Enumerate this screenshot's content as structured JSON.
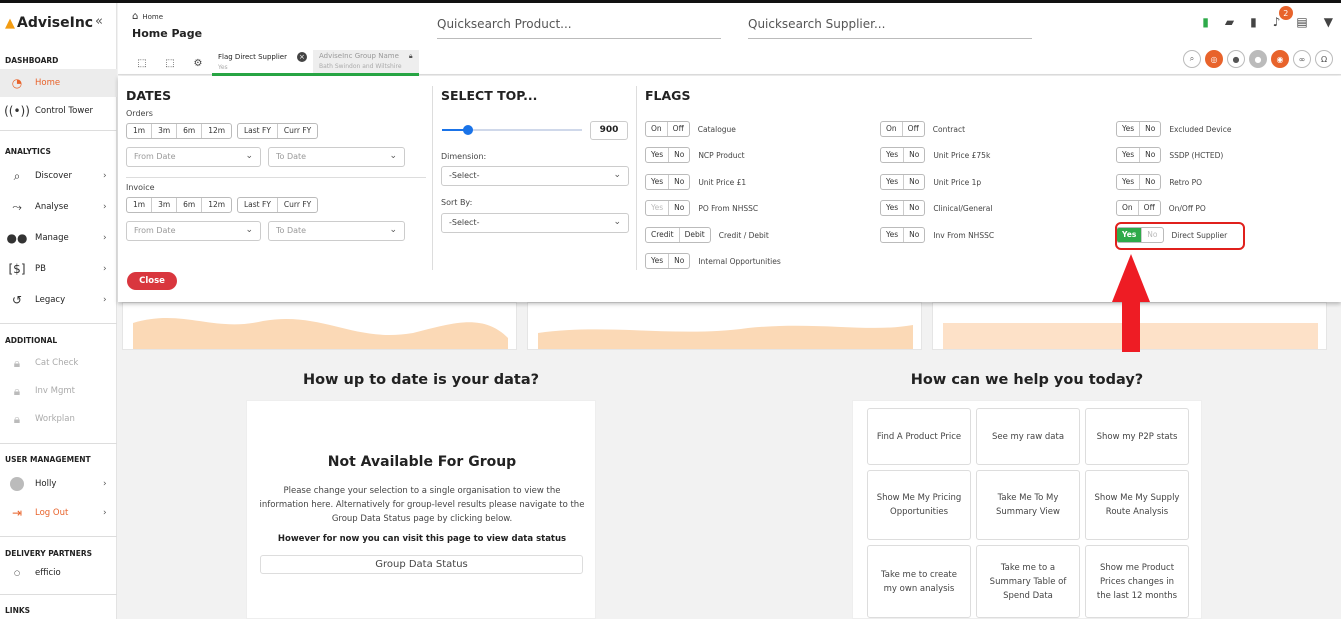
{
  "app": {
    "logo": "AdviseInc"
  },
  "sidebar": {
    "sections": {
      "dashboard": "DASHBOARD",
      "analytics": "ANALYTICS",
      "additional": "ADDITIONAL",
      "user_management": "USER MANAGEMENT",
      "delivery_partners": "DELIVERY PARTNERS",
      "links": "LINKS"
    },
    "items": {
      "home": "Home",
      "control_tower": "Control Tower",
      "discover": "Discover",
      "analyse": "Analyse",
      "manage": "Manage",
      "pb": "PB",
      "legacy": "Legacy",
      "cat_check": "Cat Check",
      "inv_mgmt": "Inv Mgmt",
      "workplan": "Workplan",
      "user": "Holly",
      "logout": "Log Out",
      "partner": "efficio"
    }
  },
  "header": {
    "breadcrumb": "Home",
    "title": "Home Page",
    "quicksearch_product": "Quicksearch Product...",
    "quicksearch_supplier": "Quicksearch Supplier...",
    "notification_count": "2",
    "chips": [
      {
        "label": "Flag Direct Supplier",
        "value": "Yes"
      },
      {
        "label": "AdviseInc Group Name",
        "value": "Bath Swindon and Wiltshire"
      }
    ]
  },
  "panel": {
    "dates": {
      "title": "DATES",
      "orders_label": "Orders",
      "invoice_label": "Invoice",
      "period_buttons": [
        "1m",
        "3m",
        "6m",
        "12m"
      ],
      "fy_buttons": [
        "Last FY",
        "Curr FY"
      ],
      "from_placeholder": "From Date",
      "to_placeholder": "To Date"
    },
    "select_top": {
      "title": "SELECT TOP...",
      "value": "900",
      "slider_fraction": 0.18,
      "dimension_label": "Dimension:",
      "dimension_value": "-Select-",
      "sortby_label": "Sort By:",
      "sortby_value": "-Select-"
    },
    "flags": {
      "title": "FLAGS",
      "col1": [
        {
          "opts": [
            "On",
            "Off"
          ],
          "label": "Catalogue"
        },
        {
          "opts": [
            "Yes",
            "No"
          ],
          "label": "NCP Product"
        },
        {
          "opts": [
            "Yes",
            "No"
          ],
          "label": "Unit Price £1"
        },
        {
          "opts": [
            "Yes",
            "No"
          ],
          "label": "PO From NHSSC"
        },
        {
          "opts": [
            "Credit",
            "Debit"
          ],
          "label": "Credit / Debit"
        },
        {
          "opts": [
            "Yes",
            "No"
          ],
          "label": "Internal Opportunities"
        }
      ],
      "col2": [
        {
          "opts": [
            "On",
            "Off"
          ],
          "label": "Contract"
        },
        {
          "opts": [
            "Yes",
            "No"
          ],
          "label": "Unit Price £75k"
        },
        {
          "opts": [
            "Yes",
            "No"
          ],
          "label": "Unit Price 1p"
        },
        {
          "opts": [
            "Yes",
            "No"
          ],
          "label": "Clinical/General"
        },
        {
          "opts": [
            "Yes",
            "No"
          ],
          "label": "Inv From NHSSC"
        }
      ],
      "col3": [
        {
          "opts": [
            "Yes",
            "No"
          ],
          "label": "Excluded Device"
        },
        {
          "opts": [
            "Yes",
            "No"
          ],
          "label": "SSDP (HCTED)"
        },
        {
          "opts": [
            "Yes",
            "No"
          ],
          "label": "Retro PO"
        },
        {
          "opts": [
            "On",
            "Off"
          ],
          "label": "On/Off PO"
        },
        {
          "opts": [
            "Yes",
            "No"
          ],
          "label": "Direct Supplier"
        }
      ],
      "active_color": "#2eaa4a"
    },
    "close_label": "Close"
  },
  "main": {
    "data_status_title": "How up to date is your data?",
    "na_title": "Not Available For Group",
    "na_text": "Please change your selection to a single organisation to view the information here. Alternatively for group-level results please navigate to the Group Data Status page by clicking below.",
    "na_bold": "However for now you can visit this page to view data status",
    "na_button": "Group Data Status",
    "help_title": "How can we help you today?",
    "help_cards": [
      "Find A Product Price",
      "See my raw data",
      "Show my P2P stats",
      "Show Me My Pricing Opportunities",
      "Take Me To My Summary View",
      "Show Me My Supply Route Analysis",
      "Take me to create my own analysis",
      "Take me to a Summary Table of Spend Data",
      "Show me Product Prices changes in the last 12 months"
    ]
  },
  "colors": {
    "accent": "#e8632b",
    "highlight": "#e0201c",
    "close": "#d9363e"
  }
}
